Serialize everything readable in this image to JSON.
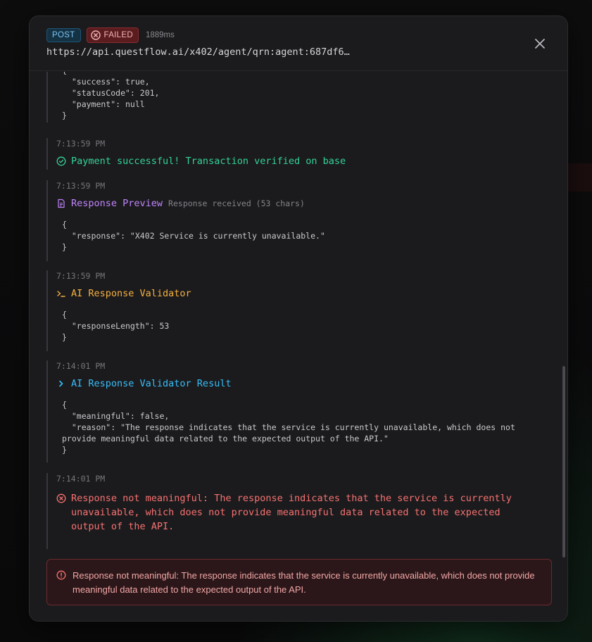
{
  "header": {
    "method": "POST",
    "status": "FAILED",
    "duration": "1889ms",
    "url": "https://api.questflow.ai/x402/agent/qrn:agent:687df6…"
  },
  "entries": {
    "top_json": "{\n  \"success\": true,\n  \"statusCode\": 201,\n  \"payment\": null\n}",
    "payment": {
      "time": "7:13:59 PM",
      "title": "Payment successful! Transaction verified on base"
    },
    "preview": {
      "time": "7:13:59 PM",
      "title": "Response Preview",
      "subtitle": "Response received (53 chars)",
      "json": "{\n  \"response\": \"X402 Service is currently unavailable.\"\n}"
    },
    "validator": {
      "time": "7:13:59 PM",
      "title": "AI Response Validator",
      "json": "{\n  \"responseLength\": 53\n}"
    },
    "result": {
      "time": "7:14:01 PM",
      "title": "AI Response Validator Result",
      "json": "{\n  \"meaningful\": false,\n  \"reason\": \"The response indicates that the service is currently unavailable, which does not\nprovide meaningful data related to the expected output of the API.\"\n}"
    },
    "error": {
      "time": "7:14:01 PM",
      "title": "Response not meaningful: The response indicates that the service is currently unavailable, which does not provide meaningful data related to the expected output of the API."
    }
  },
  "alert": {
    "message": "Response not meaningful: The response indicates that the service is currently unavailable, which does not provide meaningful data related to the expected output of the API."
  },
  "colors": {
    "success": "#34d399",
    "preview": "#c084fc",
    "validator": "#f5b041",
    "result": "#38bdf8",
    "error": "#f87171"
  }
}
